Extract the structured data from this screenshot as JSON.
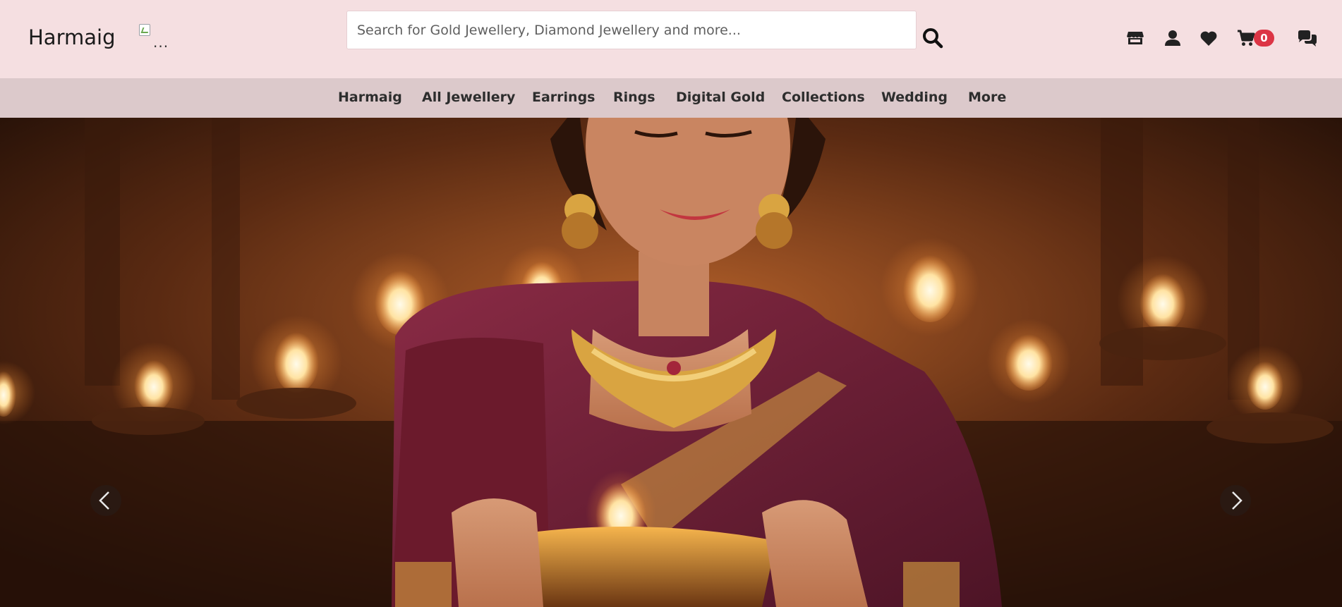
{
  "header": {
    "brand": "Harmaig",
    "logo_alt": "...",
    "search": {
      "placeholder": "Search for Gold Jewellery, Diamond Jewellery and more..."
    },
    "icons": [
      "store-icon",
      "user-icon",
      "heart-icon",
      "cart-icon",
      "chat-icon"
    ],
    "cart_count": "0"
  },
  "nav": {
    "items": [
      "Harmaig",
      "All Jewellery",
      "Earrings",
      "Rings",
      "Digital Gold",
      "Collections",
      "Wedding",
      "More"
    ]
  },
  "hero": {
    "image_subject": "woman-holding-diya-icon",
    "prev_label": "‹",
    "next_label": "›"
  },
  "colors": {
    "topbar": "#f5dfe1",
    "navbar": "#dcc9cb",
    "badge": "#dc3545",
    "saree": "#6b1e35",
    "gold": "#d9a441"
  }
}
